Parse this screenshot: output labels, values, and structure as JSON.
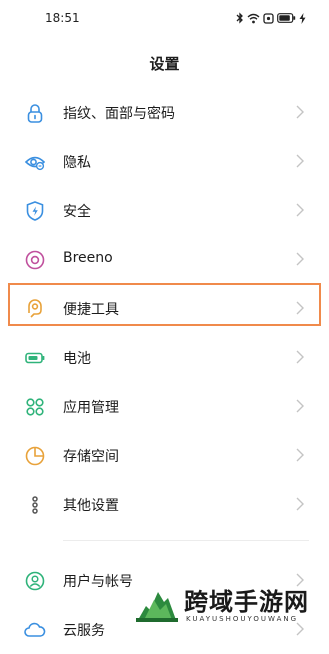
{
  "status_bar": {
    "time": "18:51"
  },
  "header": {
    "title": "设置"
  },
  "menu": [
    {
      "label": "指纹、面部与密码",
      "icon": "lock-icon"
    },
    {
      "label": "隐私",
      "icon": "privacy-eye-icon"
    },
    {
      "label": "安全",
      "icon": "shield-bolt-icon"
    },
    {
      "label": "Breeno",
      "icon": "breeno-circle-icon"
    },
    {
      "label": "便捷工具",
      "icon": "tools-hand-icon"
    },
    {
      "label": "电池",
      "icon": "battery-icon"
    },
    {
      "label": "应用管理",
      "icon": "apps-grid-icon"
    },
    {
      "label": "存储空间",
      "icon": "storage-pie-icon"
    },
    {
      "label": "其他设置",
      "icon": "more-dots-icon"
    }
  ],
  "menu2": [
    {
      "label": "用户与帐号",
      "icon": "user-icon"
    },
    {
      "label": "云服务",
      "icon": "cloud-icon"
    }
  ],
  "watermark": {
    "text": "跨域手游网",
    "subtext": "KUAYUSHOUYOUWANG"
  },
  "colors": {
    "accent_blue": "#3a8fe0",
    "highlight": "#f08a4b",
    "chevron": "#c4c4c4"
  }
}
